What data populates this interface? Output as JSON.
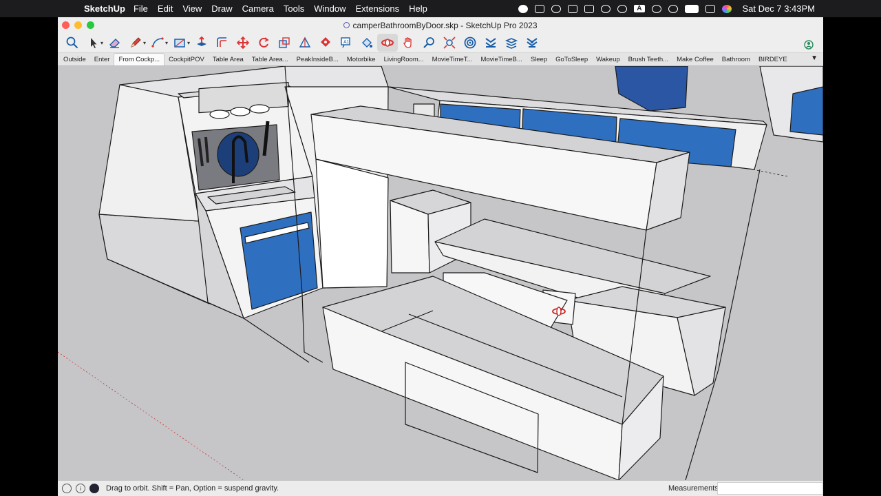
{
  "menubar": {
    "app_name": "SketchUp",
    "items": [
      "File",
      "Edit",
      "View",
      "Draw",
      "Camera",
      "Tools",
      "Window",
      "Extensions",
      "Help"
    ],
    "clock": "Sat Dec 7  3:43PM",
    "status_a_label": "A"
  },
  "window": {
    "title": "camperBathroomByDoor.skp - SketchUp Pro 2023"
  },
  "toolbar": {
    "tools": [
      "zoom-icon",
      "select-icon",
      "eraser-icon",
      "pencil-icon",
      "arc-icon",
      "rectangle-icon",
      "push-pull-icon",
      "offset-icon",
      "move-icon",
      "rotate-icon",
      "scale-icon",
      "section-plane-icon",
      "tape-measure-icon",
      "text-icon",
      "paint-bucket-icon",
      "orbit-icon",
      "pan-icon",
      "zoom-glass-icon",
      "zoom-extents-icon",
      "warehouse-icon",
      "extension-warehouse-icon",
      "layout-icon",
      "styles-icon",
      "account-icon"
    ],
    "active_tool": "orbit-icon"
  },
  "scenes": {
    "tabs": [
      "Outside",
      "Enter",
      "From Cockp...",
      "CockpitPOV",
      "Table Area",
      "Table Area...",
      "PeakInsideB...",
      "Motorbike",
      "LivingRoom...",
      "MovieTimeT...",
      "MovieTimeB...",
      "Sleep",
      "GoToSleep",
      "Wakeup",
      "Brush Teeth...",
      "Make Coffee",
      "Bathroom",
      "BIRDEYE"
    ],
    "active_index": 2,
    "more": "▼"
  },
  "statusbar": {
    "hint": "Drag to orbit. Shift = Pan, Option = suspend gravity.",
    "measurements_label": "Measurements",
    "measurements_value": ""
  },
  "colors": {
    "accent_blue": "#2f6fc0",
    "viewport_bg": "#c6c6c9",
    "close": "#ff5f57",
    "minimize": "#febc2e",
    "zoom": "#28c840"
  }
}
